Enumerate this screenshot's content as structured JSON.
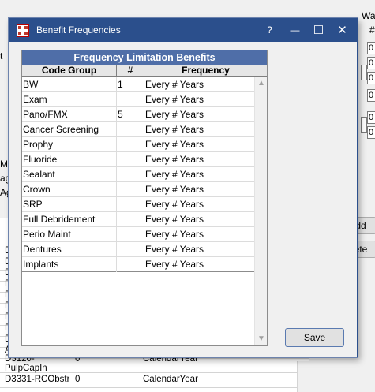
{
  "background": {
    "top_right_label": "Wai",
    "hash_label": "#",
    "side_labels": [
      "t",
      "Ma",
      "ag",
      "Age"
    ],
    "number_boxes": [
      "0",
      "0",
      "0",
      "0",
      "0",
      "0",
      "0"
    ],
    "add_button": "dd",
    "delete_button": "ete",
    "proc_codes": [
      "D",
      "D",
      "D",
      "D",
      "D",
      "D",
      "D",
      "D",
      "D",
      "A"
    ],
    "bottom_rows": [
      {
        "code": "D3120-PulpCapIn",
        "count": "0",
        "frequency": "CalendarYear"
      },
      {
        "code": "D3331-RCObstr",
        "count": "0",
        "frequency": "CalendarYear"
      }
    ]
  },
  "dialog": {
    "title": "Benefit Frequencies",
    "help_glyph": "?",
    "minimize_glyph": "—",
    "maximize_glyph": "☐",
    "close_glyph": "✕",
    "panel_title": "Frequency Limitation Benefits",
    "columns": [
      "Code Group",
      "#",
      "Frequency"
    ],
    "rows": [
      {
        "code_group": "BW",
        "count": "1",
        "frequency": "Every # Years"
      },
      {
        "code_group": "Exam",
        "count": "",
        "frequency": "Every # Years"
      },
      {
        "code_group": "Pano/FMX",
        "count": "5",
        "frequency": "Every # Years"
      },
      {
        "code_group": "Cancer Screening",
        "count": "",
        "frequency": "Every # Years"
      },
      {
        "code_group": "Prophy",
        "count": "",
        "frequency": "Every # Years"
      },
      {
        "code_group": "Fluoride",
        "count": "",
        "frequency": "Every # Years"
      },
      {
        "code_group": "Sealant",
        "count": "",
        "frequency": "Every # Years"
      },
      {
        "code_group": "Crown",
        "count": "",
        "frequency": "Every # Years"
      },
      {
        "code_group": "SRP",
        "count": "",
        "frequency": "Every # Years"
      },
      {
        "code_group": "Full Debridement",
        "count": "",
        "frequency": "Every # Years"
      },
      {
        "code_group": "Perio Maint",
        "count": "",
        "frequency": "Every # Years"
      },
      {
        "code_group": "Dentures",
        "count": "",
        "frequency": "Every # Years"
      },
      {
        "code_group": "Implants",
        "count": "",
        "frequency": "Every # Years"
      }
    ],
    "scroll_up_glyph": "▲",
    "scroll_down_glyph": "▼",
    "save_label": "Save"
  }
}
